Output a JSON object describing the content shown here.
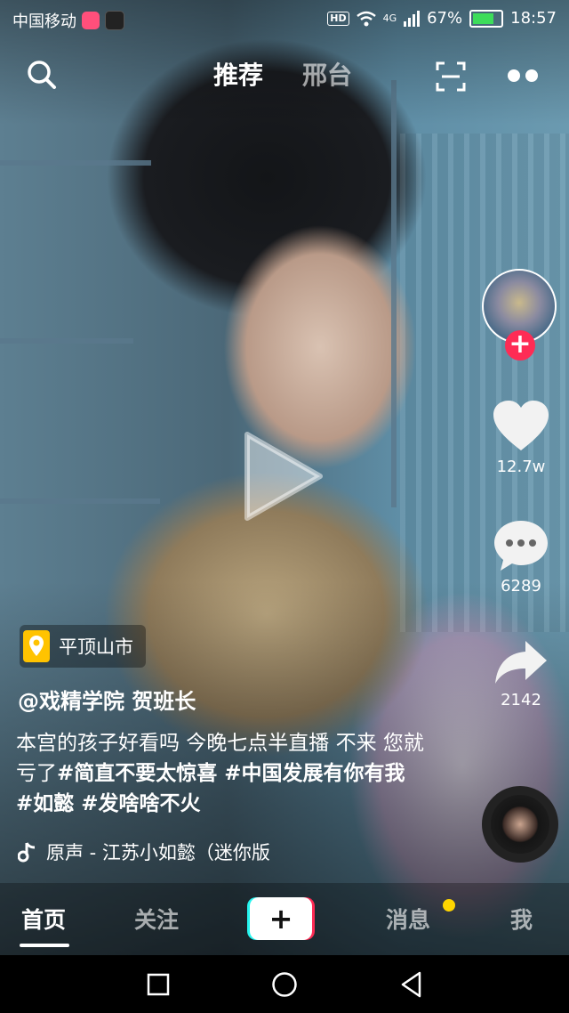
{
  "status_bar": {
    "carrier": "中国移动",
    "hd": "HD",
    "network": "4G",
    "battery": "67%",
    "time": "18:57"
  },
  "top_nav": {
    "tabs": [
      {
        "label": "推荐",
        "active": true
      },
      {
        "label": "邢台",
        "active": false
      }
    ],
    "icons": [
      "search-icon",
      "scan-icon",
      "more-dots-icon"
    ]
  },
  "rail": {
    "likes": "12.7w",
    "comments": "6289",
    "shares": "2142",
    "follow_symbol": "+"
  },
  "video": {
    "location": "平顶山市",
    "author": "@戏精学院 贺班长",
    "caption_plain": "本宫的孩子好看吗 今晚七点半直播 不来 您就亏了",
    "caption_tags": "#简直不要太惊喜 #中国发展有你有我 #如懿 #发啥啥不火",
    "music": "原声 - 江苏小如懿（迷你版"
  },
  "tab_bar": {
    "home": "首页",
    "follow": "关注",
    "create": "+",
    "messages": "消息",
    "me": "我"
  },
  "colors": {
    "accent_red": "#fe2c55",
    "notify_yellow": "#ffd500",
    "tiktok_cyan": "#25f4ee"
  }
}
